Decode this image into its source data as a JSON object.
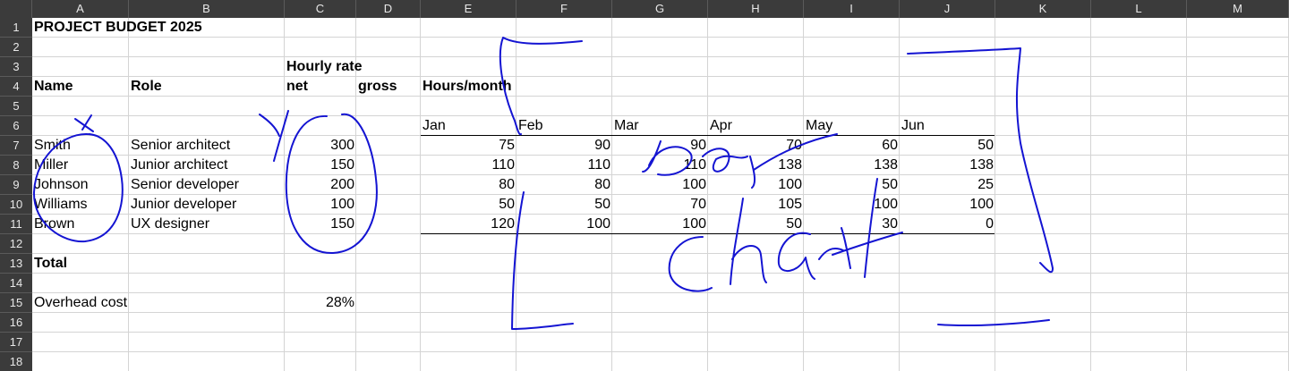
{
  "columns": [
    "A",
    "B",
    "C",
    "D",
    "E",
    "F",
    "G",
    "H",
    "I",
    "J",
    "K",
    "L",
    "M"
  ],
  "rows": [
    "1",
    "2",
    "3",
    "4",
    "5",
    "6",
    "7",
    "8",
    "9",
    "10",
    "11",
    "12",
    "13",
    "14",
    "15",
    "16",
    "17",
    "18"
  ],
  "sheet": {
    "title": "PROJECT BUDGET 2025",
    "hourly_rate_label": "Hourly rate",
    "name_header": "Name",
    "role_header": "Role",
    "net_header": "net",
    "gross_header": "gross",
    "hours_header": "Hours/month",
    "months": [
      "Jan",
      "Feb",
      "Mar",
      "Apr",
      "May",
      "Jun"
    ],
    "people": [
      {
        "name": "Smith",
        "role": "Senior architect",
        "net": "300",
        "hours": [
          "75",
          "90",
          "90",
          "70",
          "60",
          "50"
        ]
      },
      {
        "name": "Miller",
        "role": "Junior architect",
        "net": "150",
        "hours": [
          "110",
          "110",
          "110",
          "138",
          "138",
          "138"
        ]
      },
      {
        "name": "Johnson",
        "role": "Senior developer",
        "net": "200",
        "hours": [
          "80",
          "80",
          "100",
          "100",
          "50",
          "25"
        ]
      },
      {
        "name": "Williams",
        "role": "Junior developer",
        "net": "100",
        "hours": [
          "50",
          "50",
          "70",
          "105",
          "100",
          "100"
        ]
      },
      {
        "name": "Brown",
        "role": "UX designer",
        "net": "150",
        "hours": [
          "120",
          "100",
          "100",
          "50",
          "30",
          "0"
        ]
      }
    ],
    "total_label": "Total",
    "overhead_label": "Overhead cost",
    "overhead_value": "28%"
  },
  "annotations": {
    "ink_color": "#1414d2",
    "note": "hand-drawn ink: x marks, circles around Name and net columns, bracket with handwritten words 'bar chart'"
  }
}
